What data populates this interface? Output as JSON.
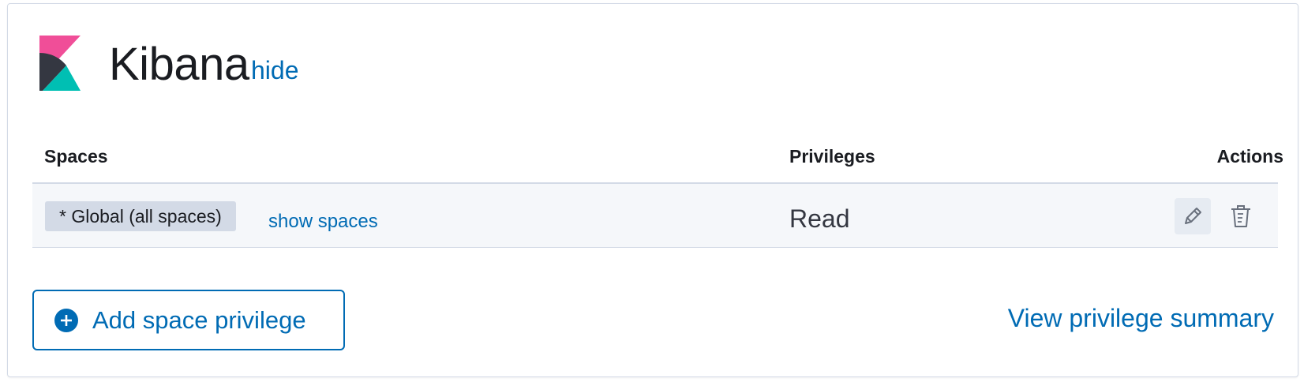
{
  "app": {
    "title": "Kibana",
    "hide_label": "hide"
  },
  "table": {
    "headers": {
      "spaces": "Spaces",
      "privileges": "Privileges",
      "actions": "Actions"
    },
    "rows": [
      {
        "space_badge": "* Global (all spaces)",
        "show_spaces_label": "show spaces",
        "privilege": "Read",
        "actions": [
          "pencil-icon",
          "trash-icon"
        ]
      }
    ]
  },
  "footer": {
    "add_button_label": "Add space privilege",
    "summary_link_label": "View privilege summary"
  },
  "colors": {
    "link": "#006bb4",
    "text": "#1a1c21",
    "badge_bg": "#d3dae6",
    "row_bg": "#f5f7fa",
    "logo_pink": "#f04e98",
    "logo_dark": "#343741",
    "logo_teal": "#00bfb3"
  }
}
